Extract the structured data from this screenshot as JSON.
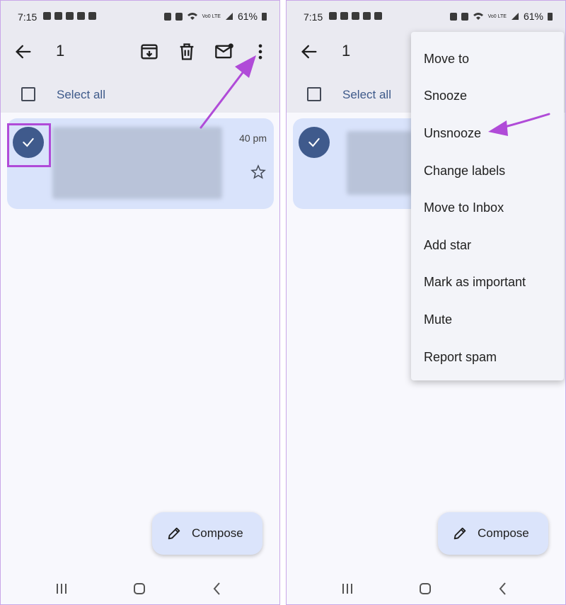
{
  "status": {
    "time": "7:15",
    "battery": "61%",
    "network": "Vo0 LTE"
  },
  "toolbar": {
    "selected_count": "1"
  },
  "list": {
    "select_all_label": "Select all",
    "email_time_partial": "40 pm"
  },
  "compose": {
    "label": "Compose"
  },
  "menu": {
    "items": [
      "Move to",
      "Snooze",
      "Unsnooze",
      "Change labels",
      "Move to Inbox",
      "Add star",
      "Mark as important",
      "Mute",
      "Report spam"
    ]
  },
  "colors": {
    "accent_highlight": "#b04bd8",
    "selected_card": "#d9e3fb",
    "check_circle": "#3f5a8c",
    "select_all_text": "#3e5a8a"
  }
}
